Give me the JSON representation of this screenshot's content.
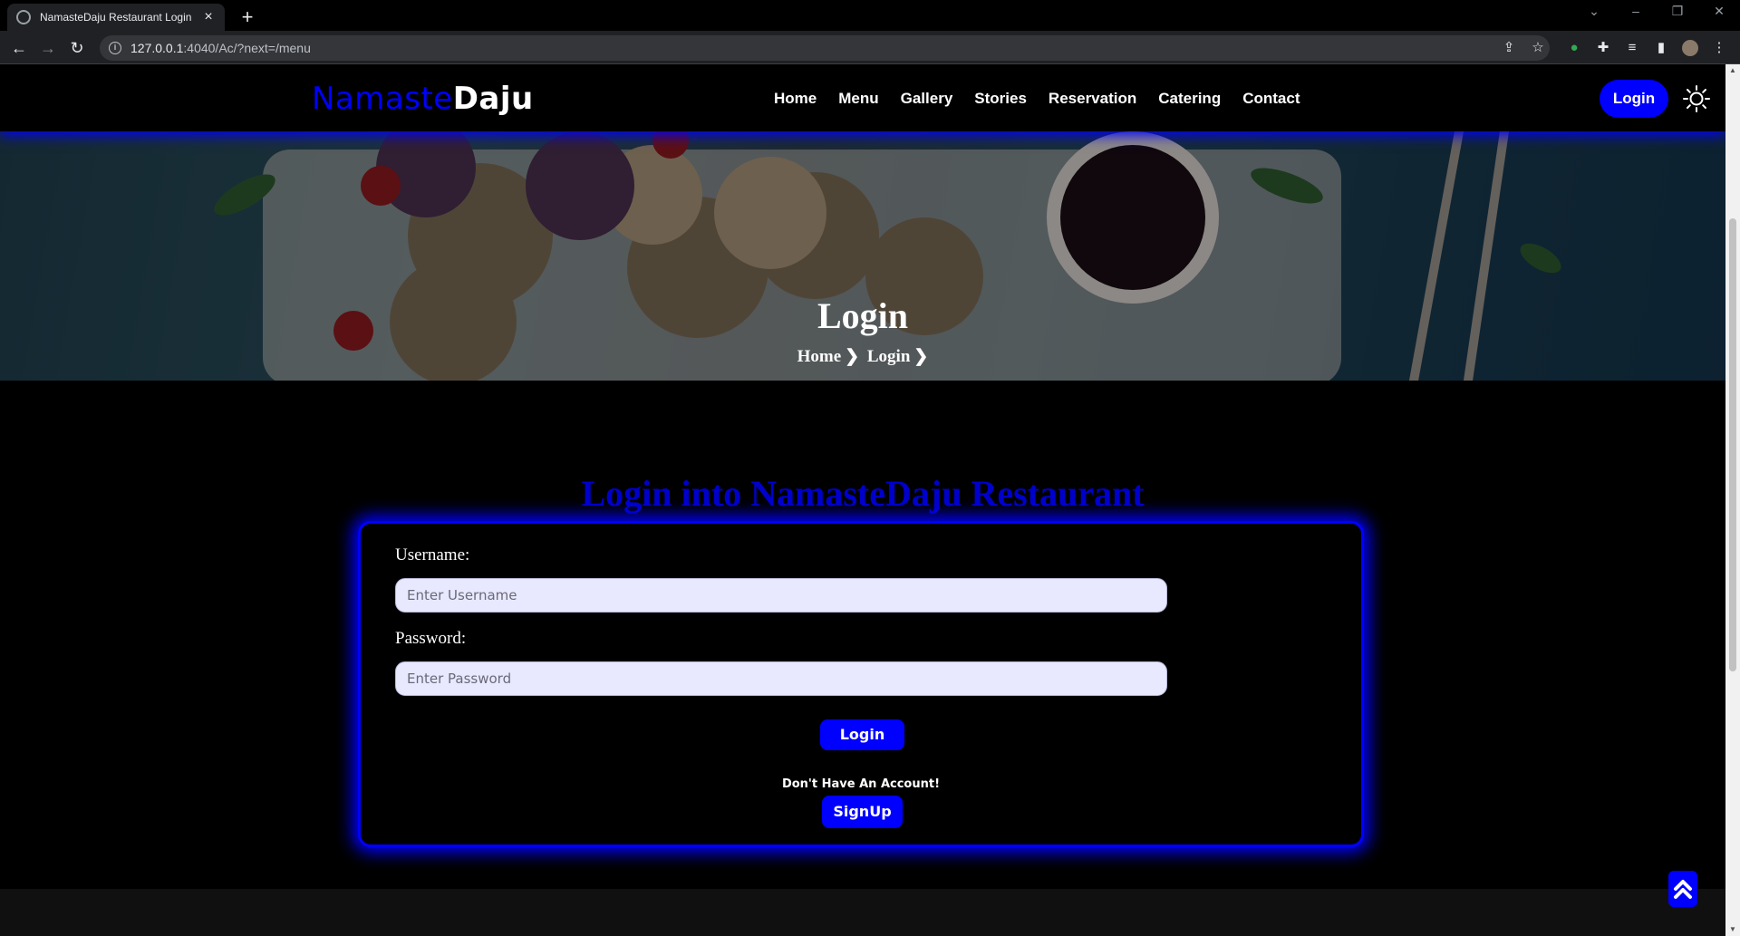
{
  "browser": {
    "tab_title": "NamasteDaju Restaurant Login",
    "url_host": "127.0.0.1",
    "url_rest": ":4040/Ac/?next=/menu"
  },
  "site": {
    "logo_part1": "Namaste",
    "logo_part2": "Daju",
    "nav": [
      "Home",
      "Menu",
      "Gallery",
      "Stories",
      "Reservation",
      "Catering",
      "Contact"
    ],
    "login_button": "Login"
  },
  "hero": {
    "title": "Login",
    "breadcrumb": [
      "Home",
      "Login"
    ]
  },
  "form": {
    "heading": "Login into NamasteDaju Restaurant",
    "username_label": "Username:",
    "username_placeholder": "Enter Username",
    "password_label": "Password:",
    "password_placeholder": "Enter Password",
    "submit": "Login",
    "no_account": "Don't Have An Account!",
    "signup": "SignUp"
  },
  "colors": {
    "accent": "#0000ff",
    "background": "#000000",
    "input_bg": "#e8e8ff"
  }
}
